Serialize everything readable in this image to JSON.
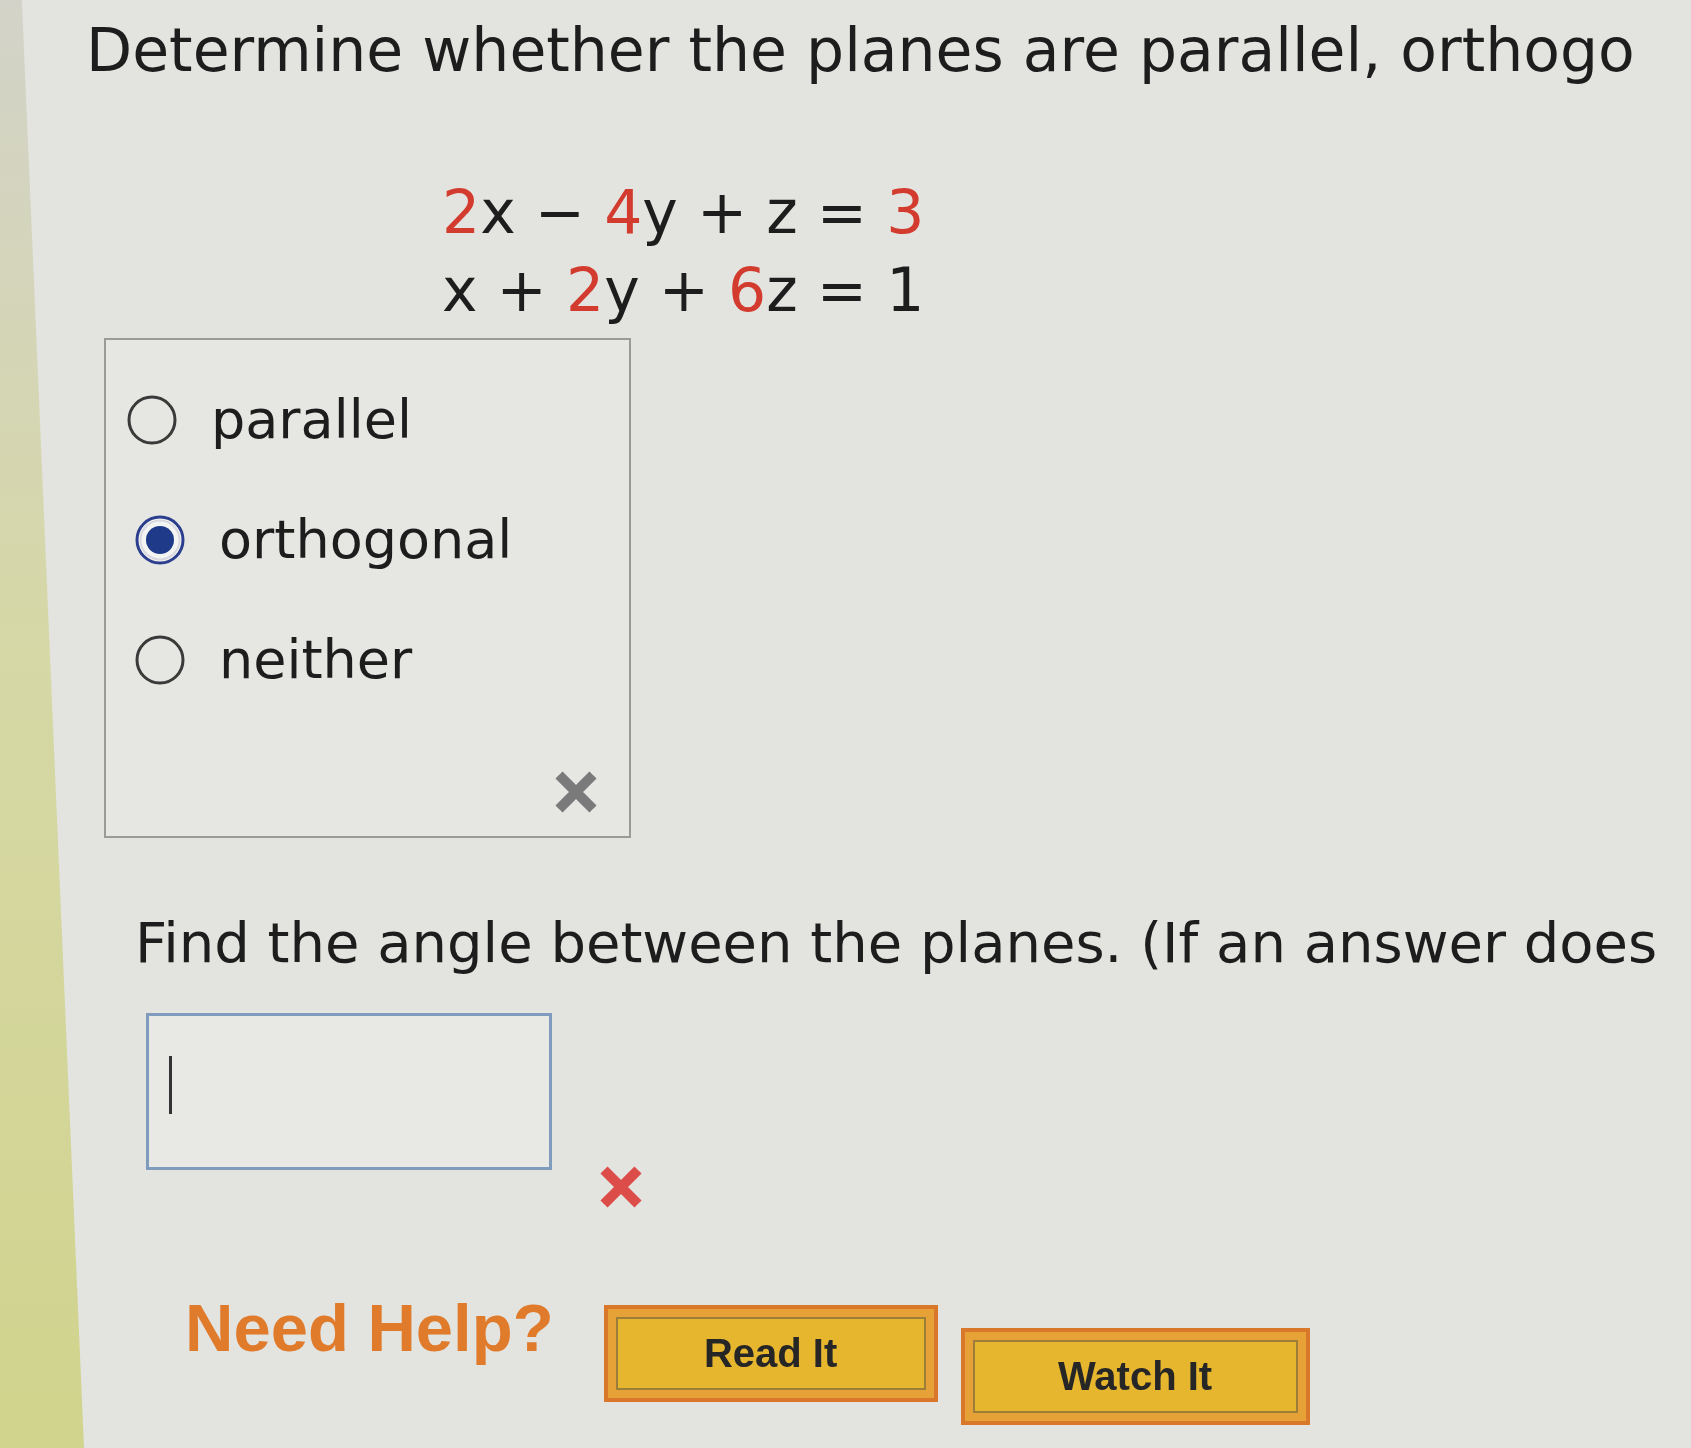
{
  "question": {
    "text": "Determine whether the planes are parallel, orthogo"
  },
  "equations": [
    {
      "parts": [
        {
          "text": "2",
          "highlighted": true
        },
        {
          "text": "x − ",
          "highlighted": false
        },
        {
          "text": "4",
          "highlighted": true
        },
        {
          "text": "y + z = ",
          "highlighted": false
        },
        {
          "text": "3",
          "highlighted": true
        }
      ]
    },
    {
      "parts": [
        {
          "text": "x + ",
          "highlighted": false
        },
        {
          "text": "2",
          "highlighted": true
        },
        {
          "text": "y + ",
          "highlighted": false
        },
        {
          "text": "6",
          "highlighted": true
        },
        {
          "text": "z = 1",
          "highlighted": false
        }
      ]
    }
  ],
  "choices": {
    "options": [
      {
        "label": "parallel",
        "selected": false
      },
      {
        "label": "orthogonal",
        "selected": true
      },
      {
        "label": "neither",
        "selected": false
      }
    ],
    "marked_incorrect": true
  },
  "angle_question": {
    "text": "Find the angle between the planes. (If an answer does"
  },
  "answer": {
    "focused": true,
    "marked_incorrect": true
  },
  "help": {
    "label": "Need Help?",
    "buttons": [
      "Read It",
      "Watch It"
    ]
  }
}
